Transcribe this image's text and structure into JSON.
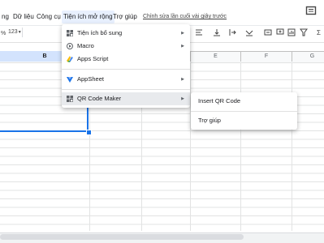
{
  "menubar": {
    "items": [
      "ng",
      "Dữ liệu",
      "Công cụ",
      "Tiện ích mở rộng",
      "Trợ giúp"
    ],
    "last_edit": "Chỉnh sửa lần cuối vài giây trước"
  },
  "toolbar": {
    "number_format": "123"
  },
  "columns": [
    "B",
    "E",
    "F",
    "G"
  ],
  "extensions_menu": {
    "items": [
      {
        "label": "Tiện ích bổ sung",
        "icon": "addon-icon",
        "has_submenu": true
      },
      {
        "label": "Macro",
        "icon": "macro-icon",
        "has_submenu": true
      },
      {
        "label": "Apps Script",
        "icon": "apps-script-icon",
        "has_submenu": false
      },
      {
        "label": "AppSheet",
        "icon": "appsheet-icon",
        "has_submenu": true
      },
      {
        "label": "QR Code Maker",
        "icon": "addon-icon",
        "has_submenu": true
      }
    ]
  },
  "qr_submenu": {
    "items": [
      "Insert QR Code",
      "Trợ giúp"
    ]
  },
  "colors": {
    "accent": "#1a73e8",
    "menu_highlight": "#e8f0fe"
  }
}
